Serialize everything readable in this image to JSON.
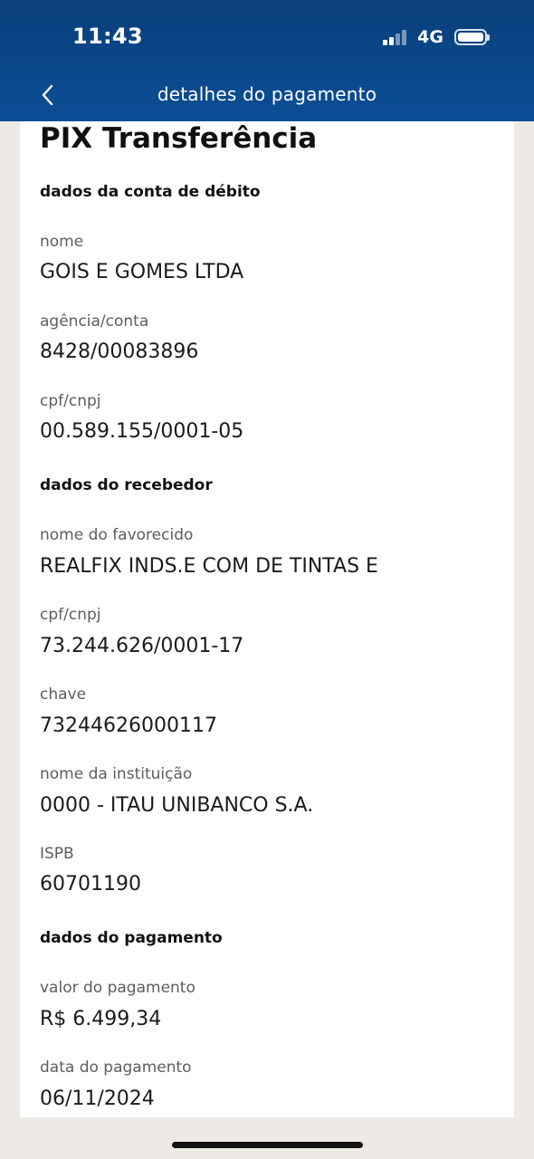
{
  "status_bar": {
    "time": "11:43",
    "network": "4G"
  },
  "header": {
    "title": "detalhes do pagamento",
    "back_icon": "chevron-left-icon"
  },
  "page": {
    "title": "PIX Transferência"
  },
  "debit_account": {
    "section_title": "dados da conta de débito",
    "name_label": "nome",
    "name_value": "GOIS E GOMES LTDA",
    "branch_label": "agência/conta",
    "branch_value": "8428/00083896",
    "doc_label": "cpf/cnpj",
    "doc_value": "00.589.155/0001-05"
  },
  "receiver": {
    "section_title": "dados do recebedor",
    "name_label": "nome do favorecido",
    "name_value": "REALFIX INDS.E COM DE TINTAS E",
    "doc_label": "cpf/cnpj",
    "doc_value": "73.244.626/0001-17",
    "key_label": "chave",
    "key_value": "73244626000117",
    "institution_label": "nome da instituição",
    "institution_value": "0000 - ITAU UNIBANCO S.A.",
    "ispb_label": "ISPB",
    "ispb_value": "60701190"
  },
  "payment": {
    "section_title": "dados do pagamento",
    "amount_label": "valor do pagamento",
    "amount_value": "R$ 6.499,34",
    "date_label": "data do pagamento",
    "date_value": "06/11/2024"
  },
  "colors": {
    "header_bg": "#0b4e95",
    "page_bg": "#ede9e5",
    "card_bg": "#ffffff"
  }
}
